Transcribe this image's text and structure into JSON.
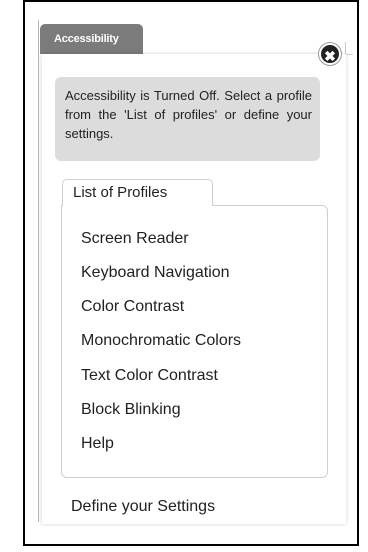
{
  "panel": {
    "tab_label": "Accessibility",
    "close_glyph": "✖",
    "notice_text": "Accessibility is Turned Off. Select a profile from the 'List of profiles' or define your settings."
  },
  "profiles": {
    "tab_label": "List of Profiles",
    "items": [
      "Screen Reader",
      "Keyboard Navigation",
      "Color Contrast",
      "Monochromatic Colors",
      "Text Color Contrast",
      "Block Blinking",
      "Help"
    ]
  },
  "settings": {
    "define_label": "Define your Settings"
  },
  "colors": {
    "tab_bg": "#7b7b7b",
    "notice_bg": "#dcdcdc",
    "close_bg": "#222222",
    "border": "#cfcfcf"
  }
}
